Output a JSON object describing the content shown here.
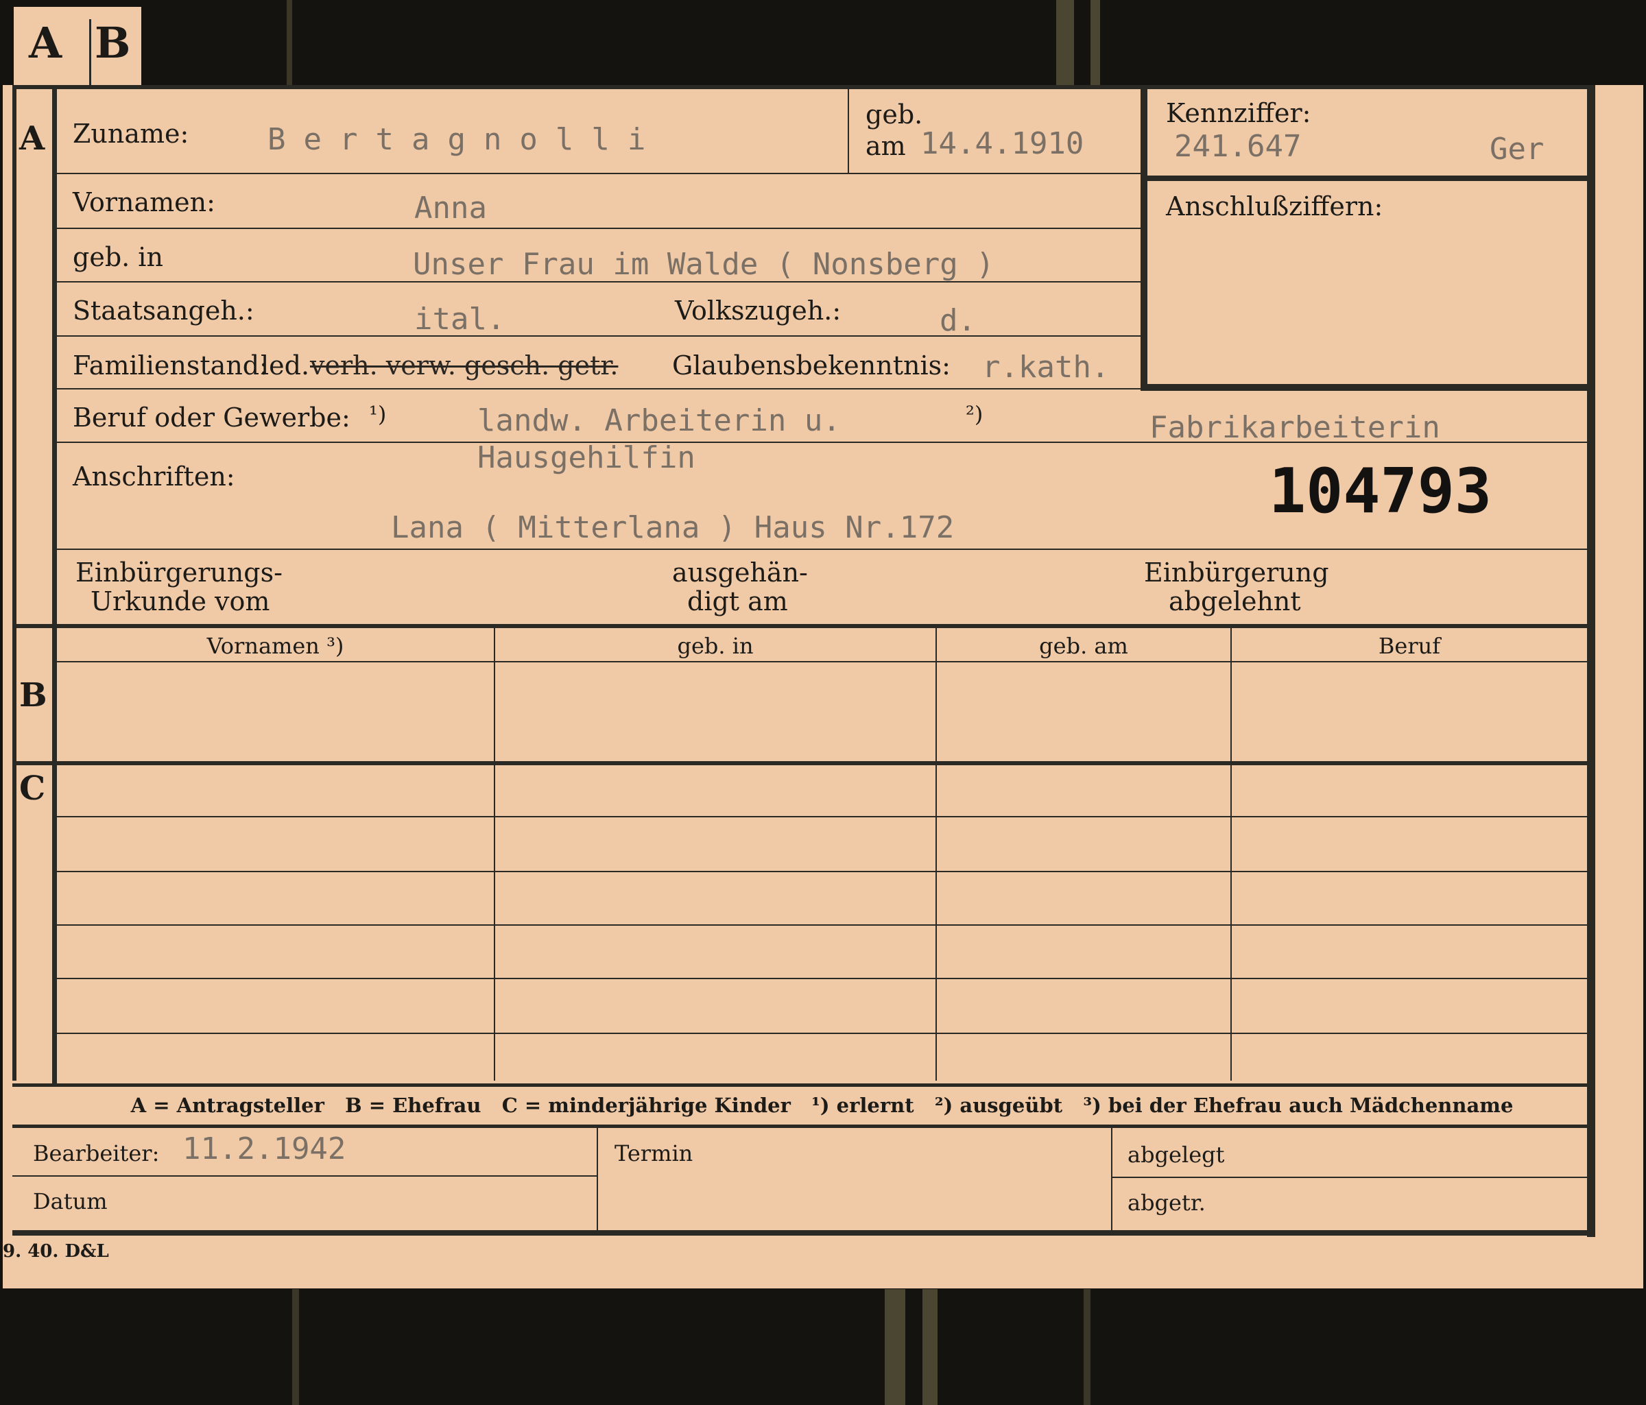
{
  "tabs": [
    "A",
    "B"
  ],
  "section_a": {
    "marker": "A",
    "zuname_label": "Zuname:",
    "zuname_value": "Bertagnolli",
    "geb_label_top": "geb.",
    "geb_label_am": "am",
    "geb_am_value": "14.4.1910",
    "kennziffer_label": "Kennziffer:",
    "kennziffer_value": "241.647",
    "kennziffer_suffix": "Ger",
    "anschluss_label": "Anschlußziffern:",
    "vornamen_label": "Vornamen:",
    "vornamen_value": "Anna",
    "geb_in_label": "geb. in",
    "geb_in_value": "Unser Frau im Walde ( Nonsberg )",
    "staatsangeh_label": "Staatsangeh.:",
    "staatsangeh_value": "ital.",
    "volkszugeh_label": "Volkszugeh.:",
    "volkszugeh_value": "d.",
    "familienstand_label": "Familienstand:",
    "familienstand_kept": "led.",
    "familienstand_struck": "verh. verw. gesch. getr.",
    "glauben_label": "Glaubensbekenntnis:",
    "glauben_value": "r.kath.",
    "beruf_label": "Beruf oder Gewerbe:",
    "beruf_fn1": "¹)",
    "beruf_value_1": "landw. Arbeiterin u.",
    "beruf_value_1b": "Hausgehilfin",
    "beruf_fn2": "²)",
    "beruf_value_2": "Fabrikarbeiterin",
    "anschriften_label": "Anschriften:",
    "anschriften_value": "Lana ( Mitterlana ) Haus Nr.172",
    "card_number": "104793",
    "einb_urkunde_l1": "Einbürgerungs-",
    "einb_urkunde_l2": "Urkunde vom",
    "ausgehaen_l1": "ausgehän-",
    "ausgehaen_l2": "digt am",
    "einb_abgelehnt_l1": "Einbürgerung",
    "einb_abgelehnt_l2": "abgelehnt"
  },
  "section_b": {
    "marker": "B",
    "columns": [
      "Vornamen ³)",
      "geb. in",
      "geb. am",
      "Beruf"
    ]
  },
  "section_c": {
    "marker": "C"
  },
  "legend": "A = Antragsteller   B = Ehefrau   C = minderjährige Kinder   ¹) erlernt   ²) ausgeübt   ³) bei der Ehefrau auch Mädchenname",
  "footer": {
    "bearbeiter_label": "Bearbeiter:",
    "bearbeiter_value": "11.2.1942",
    "datum_label": "Datum",
    "termin_label": "Termin",
    "abgelegt_label": "abgelegt",
    "abgetr_label": "abgetr."
  },
  "print_mark": "9. 40. D&L",
  "colors": {
    "card": "#f0c9a6",
    "ink": "#1d1b18",
    "typewriter": "#7a7065",
    "background": "#151310"
  }
}
